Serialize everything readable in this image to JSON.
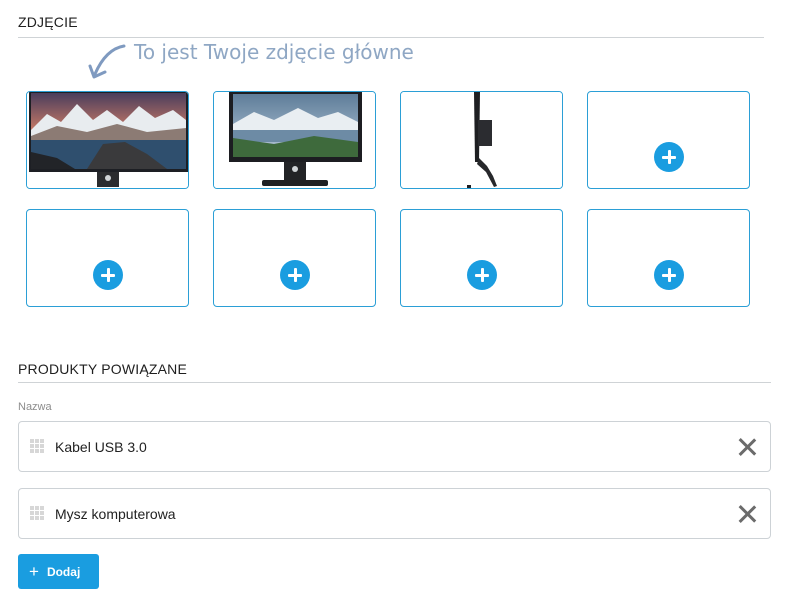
{
  "photos": {
    "section_title": "ZDJĘCIE",
    "main_hint": "To jest Twoje zdjęcie główne",
    "slots": [
      {
        "state": "image",
        "subject": "monitor-mountain-lake-front"
      },
      {
        "state": "image",
        "subject": "monitor-landscape-front"
      },
      {
        "state": "image",
        "subject": "monitor-side-view"
      },
      {
        "state": "empty"
      },
      {
        "state": "empty"
      },
      {
        "state": "empty"
      },
      {
        "state": "empty"
      },
      {
        "state": "empty"
      }
    ]
  },
  "related_products": {
    "section_title": "PRODUKTY POWIĄZANE",
    "name_label": "Nazwa",
    "items": [
      {
        "name": "Kabel USB 3.0"
      },
      {
        "name": "Mysz komputerowa"
      }
    ],
    "add_label": "Dodaj"
  },
  "colors": {
    "accent": "#1a9de0",
    "slot_border": "#2b9fd6",
    "hint_text": "#8fa7c4"
  }
}
